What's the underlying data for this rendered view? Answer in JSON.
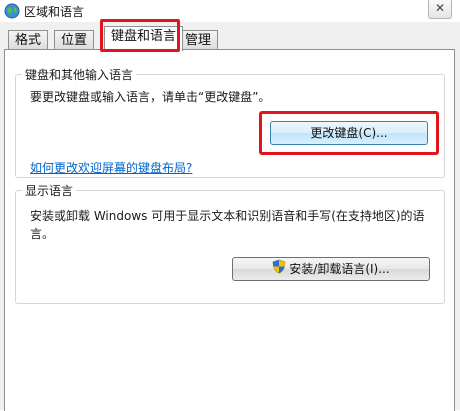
{
  "window": {
    "title": "区域和语言",
    "close_label": "✕"
  },
  "tabs": [
    {
      "label": "格式"
    },
    {
      "label": "位置"
    },
    {
      "label": "键盘和语言"
    },
    {
      "label": "管理"
    }
  ],
  "keyboard_group": {
    "title": "键盘和其他输入语言",
    "description": "要更改键盘或输入语言，请单击“更改键盘”。",
    "change_button": "更改键盘(C)...",
    "help_link": "如何更改欢迎屏幕的键盘布局?"
  },
  "display_group": {
    "title": "显示语言",
    "description": "安装或卸载 Windows 可用于显示文本和识别语音和手写(在支持地区)的语言。",
    "install_button": "安装/卸载语言(I)..."
  },
  "colors": {
    "highlight": "#e0151d",
    "link": "#0066cc"
  }
}
